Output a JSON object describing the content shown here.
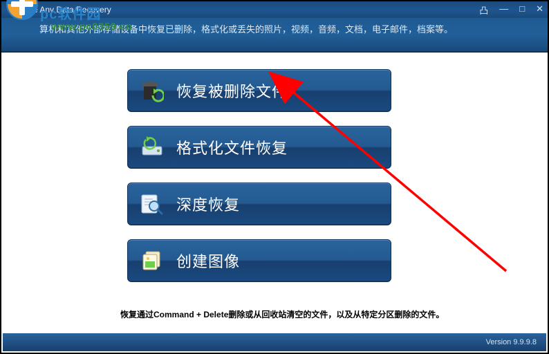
{
  "window": {
    "title": "Free Any Data Recovery",
    "controls": {
      "tray": "凸",
      "min": "—",
      "max": "□",
      "close": "✕"
    }
  },
  "header": {
    "subtitle": "算机和其他外部存储设备中恢复已删除，格式化或丢失的照片，视频，音频，文档，电子邮件，档案等。"
  },
  "watermark": {
    "line1": "pc软件园",
    "line2": "www.pc0359.cn"
  },
  "buttons": {
    "recover_deleted": "恢复被删除文件",
    "recover_formatted": "格式化文件恢复",
    "deep_recovery": "深度恢复",
    "create_image": "创建图像"
  },
  "hint": "恢复通过Command + Delete删除或从回收站清空的文件，以及从特定分区删除的文件。",
  "footer": {
    "version": "Version 9.9.9.8"
  },
  "icons": {
    "title_icon": "disk-icon",
    "btn1": "trash-recover-icon",
    "btn2": "drive-icon",
    "btn3": "magnifier-icon",
    "btn4": "image-copy-icon"
  }
}
